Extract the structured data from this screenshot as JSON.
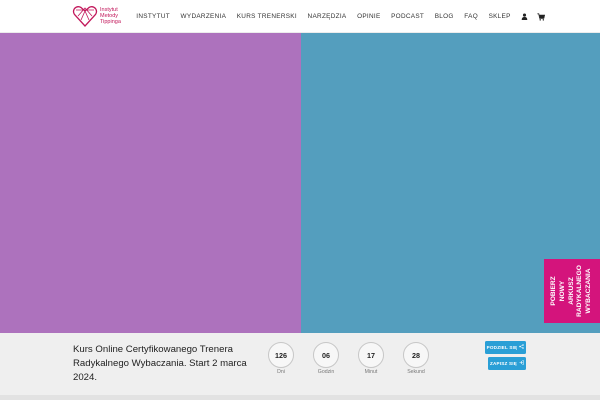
{
  "colors": {
    "brand": "#d4147c",
    "panel_left": "#ad72bd",
    "panel_right": "#549ebe",
    "button": "#2a9fd6",
    "bottom_bar": "#efefef"
  },
  "header": {
    "logo": {
      "line1": "Instytut",
      "line2": "Metody",
      "line3": "Tippinga",
      "icon": "heart-logo-icon"
    },
    "nav": [
      {
        "label": "INSTYTUT"
      },
      {
        "label": "WYDARZENIA"
      },
      {
        "label": "KURS TRENERSKI"
      },
      {
        "label": "NARZĘDZIA"
      },
      {
        "label": "OPINIE"
      },
      {
        "label": "PODCAST"
      },
      {
        "label": "BLOG"
      },
      {
        "label": "FAQ"
      },
      {
        "label": "SKLEP"
      }
    ],
    "icons": [
      "user-icon",
      "cart-icon"
    ]
  },
  "side_tab": {
    "line1": "POBIERZ",
    "line2": "NOWY",
    "line3": "ARKUSZ",
    "line4": "RADYKALNEGO",
    "line5": "WYBACZANIA"
  },
  "promo": {
    "title": "Kurs Online Certyfikowanego Trenera Radykalnego Wybaczania. Start 2 marca 2024.",
    "countdown": [
      {
        "value": "126",
        "label": "Dni"
      },
      {
        "value": "06",
        "label": "Godzin"
      },
      {
        "value": "17",
        "label": "Minut"
      },
      {
        "value": "28",
        "label": "Sekund"
      }
    ],
    "share_button": "PODZIEL SIĘ",
    "signup_button": "ZAPISZ SIĘ"
  }
}
